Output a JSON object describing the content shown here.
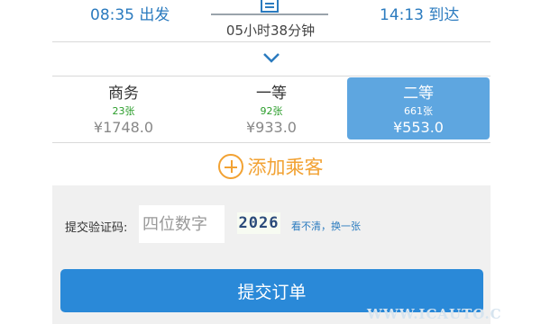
{
  "train": {
    "depart": "08:35 出发",
    "arrive": "14:13 到达",
    "duration": "05小时38分钟"
  },
  "seats": [
    {
      "name": "商务",
      "count": "23张",
      "price": "¥1748.0",
      "selected": false
    },
    {
      "name": "一等",
      "count": "92张",
      "price": "¥933.0",
      "selected": false
    },
    {
      "name": "二等",
      "count": "661张",
      "price": "¥553.0",
      "selected": true
    }
  ],
  "add_passenger": {
    "label": "添加乘客"
  },
  "verification": {
    "label": "提交验证码:",
    "placeholder": "四位数字",
    "captcha": "2026",
    "refresh": "看不清，换一张"
  },
  "submit": {
    "label": "提交订单"
  },
  "watermark": "WWW.ICAUTO.C",
  "colors": {
    "accent": "#2b7bbf",
    "selected_seat": "#5ea6e0",
    "submit": "#2a89d8",
    "add": "#f2a233",
    "ticket_count": "#2a9d2a"
  }
}
